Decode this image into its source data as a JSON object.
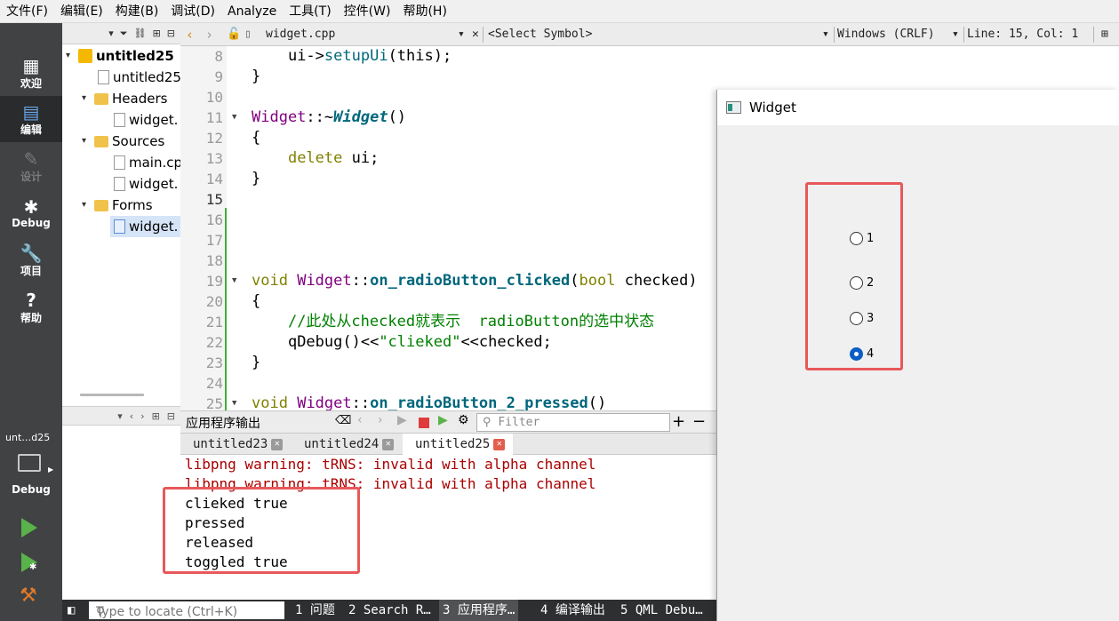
{
  "menu": [
    "文件(F)",
    "编辑(E)",
    "构建(B)",
    "调试(D)",
    "Analyze",
    "工具(T)",
    "控件(W)",
    "帮助(H)"
  ],
  "modes": [
    {
      "label": "欢迎",
      "icon": "grid-icon"
    },
    {
      "label": "编辑",
      "icon": "document-icon"
    },
    {
      "label": "设计",
      "icon": "pen-icon"
    },
    {
      "label": "Debug",
      "icon": "bug-icon"
    },
    {
      "label": "项目",
      "icon": "wrench-icon"
    },
    {
      "label": "帮助",
      "icon": "help-icon"
    }
  ],
  "kit": {
    "name": "unt…d25",
    "build": "Debug"
  },
  "tree": {
    "project": "untitled25",
    "pro_file": "untitled25",
    "headers": "Headers",
    "header_file": "widget.",
    "sources": "Sources",
    "source_main": "main.cp",
    "source_widget": "widget.",
    "forms": "Forms",
    "form_file": "widget."
  },
  "editor": {
    "file_name": "widget.cpp",
    "symbol": "<Select Symbol>",
    "line_ending": "Windows (CRLF)",
    "position": "Line: 15, Col: 1"
  },
  "code_lines": [
    {
      "num": "8"
    },
    {
      "num": "9"
    },
    {
      "num": "10"
    },
    {
      "num": "11"
    },
    {
      "num": "12"
    },
    {
      "num": "13"
    },
    {
      "num": "14"
    },
    {
      "num": "15"
    },
    {
      "num": "16"
    },
    {
      "num": "17"
    },
    {
      "num": "18"
    },
    {
      "num": "19"
    },
    {
      "num": "20"
    },
    {
      "num": "21"
    },
    {
      "num": "22"
    },
    {
      "num": "23"
    },
    {
      "num": "24"
    },
    {
      "num": "25"
    }
  ],
  "code": {
    "l8_obj": "ui->",
    "l8_fn": "setupUi",
    "l8_arg": "(this);",
    "l9": "}",
    "l11_cls": "Widget",
    "l11_sep": "::~",
    "l11_fn": "Widget",
    "l11_end": "()",
    "l12": "{",
    "l13_kw": "delete",
    "l13_rest": " ui;",
    "l14": "}",
    "l19_kw": "void",
    "l19_cls": "Widget",
    "l19_sep": "::",
    "l19_fn": "on_radioButton_clicked",
    "l19_args_kw": "bool",
    "l19_args": " checked)",
    "l20": "{",
    "l21_comment": "//此处从checked就表示  radioButton的选中状态",
    "l22_a": "qDebug()<<",
    "l22_str": "\"clieked\"",
    "l22_b": "<<checked;",
    "l23": "}",
    "l25_kw": "void",
    "l25_cls": "Widget",
    "l25_sep": "::",
    "l25_fn": "on_radioButton_2_pressed",
    "l25_end": "()"
  },
  "output": {
    "title": "应用程序输出",
    "filter_placeholder": "Filter",
    "tabs": [
      {
        "label": "untitled23"
      },
      {
        "label": "untitled24"
      },
      {
        "label": "untitled25"
      }
    ],
    "lines": [
      "libpng warning: tRNS: invalid with alpha channel",
      "libpng warning: tRNS: invalid with alpha channel",
      "clieked true",
      "pressed",
      "released",
      "toggled true"
    ]
  },
  "statusbar": {
    "locate_placeholder": "Type to locate (Ctrl+K)",
    "items": [
      "1 问题",
      "2 Search R…",
      "3 应用程序…",
      "4 编译输出",
      "5 QML Debu…"
    ]
  },
  "widget_window": {
    "title": "Widget",
    "radios": [
      {
        "label": "1",
        "checked": false
      },
      {
        "label": "2",
        "checked": false
      },
      {
        "label": "3",
        "checked": false
      },
      {
        "label": "4",
        "checked": true
      }
    ]
  },
  "colors": {
    "accent_red": "#e8585a",
    "radio_selected": "#0a5fc4",
    "change_marker": "#3fae3f"
  }
}
